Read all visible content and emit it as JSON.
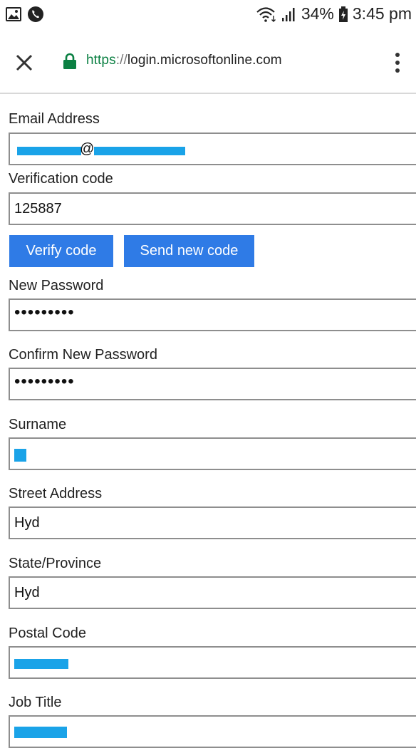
{
  "status_bar": {
    "battery": "34%",
    "time": "3:45 pm"
  },
  "url_bar": {
    "scheme": "https",
    "separator": "://",
    "host": "login.microsoftonline.com"
  },
  "form": {
    "email_label": "Email Address",
    "email_at": "@",
    "verification_label": "Verification code",
    "verification_value": "125887",
    "verify_button": "Verify code",
    "send_new_code_button": "Send new code",
    "new_password_label": "New Password",
    "new_password_value": "•••••••••",
    "confirm_password_label": "Confirm New Password",
    "confirm_password_value": "•••••••••",
    "surname_label": "Surname",
    "street_label": "Street Address",
    "street_value": "Hyd",
    "state_label": "State/Province",
    "state_value": "Hyd",
    "postal_label": "Postal Code",
    "job_title_label": "Job Title"
  },
  "colors": {
    "button": "#2f7be6",
    "lock": "#0b8043",
    "redaction": "#1aa3e8"
  }
}
